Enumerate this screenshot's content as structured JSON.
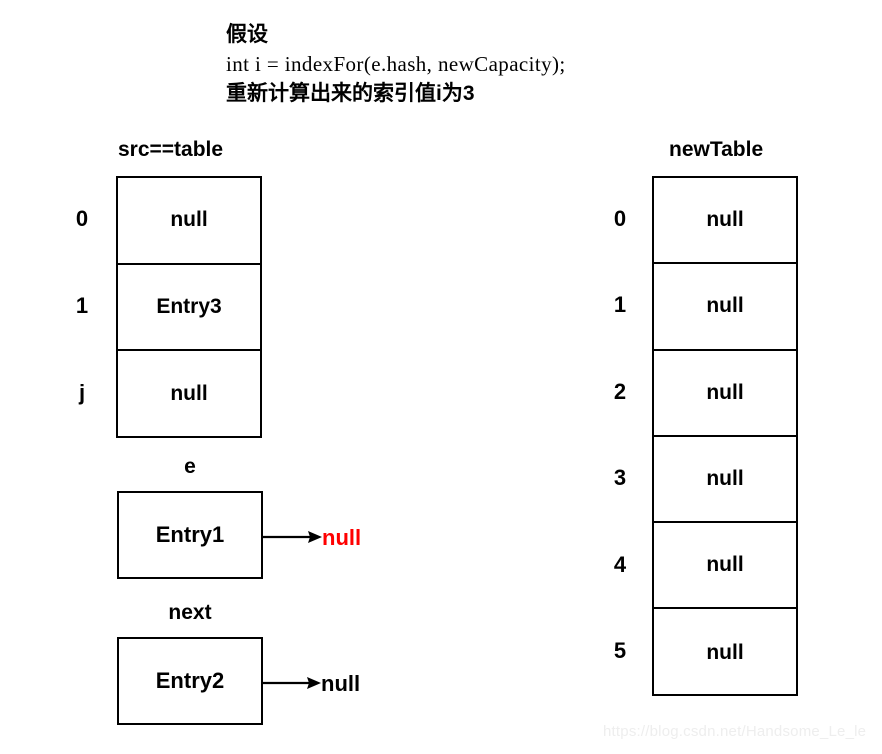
{
  "caption": {
    "line1": "假设",
    "line2": "int i = indexFor(e.hash, newCapacity);",
    "line3": "重新计算出来的索引值i为3"
  },
  "src_table": {
    "header": "src==table",
    "rows": [
      {
        "index": "0",
        "value": "null"
      },
      {
        "index": "1",
        "value": "Entry3"
      },
      {
        "index": "j",
        "value": "null"
      }
    ]
  },
  "new_table": {
    "header": "newTable",
    "rows": [
      {
        "index": "0",
        "value": "null"
      },
      {
        "index": "1",
        "value": "null"
      },
      {
        "index": "2",
        "value": "null"
      },
      {
        "index": "3",
        "value": "null"
      },
      {
        "index": "4",
        "value": "null"
      },
      {
        "index": "5",
        "value": "null"
      }
    ]
  },
  "nodes": [
    {
      "label": "e",
      "value": "Entry1",
      "next_label": "null",
      "next_color": "#ff0000"
    },
    {
      "label": "next",
      "value": "Entry2",
      "next_label": "null",
      "next_color": "#000000"
    }
  ],
  "watermark": "https://blog.csdn.net/Handsome_Le_le"
}
